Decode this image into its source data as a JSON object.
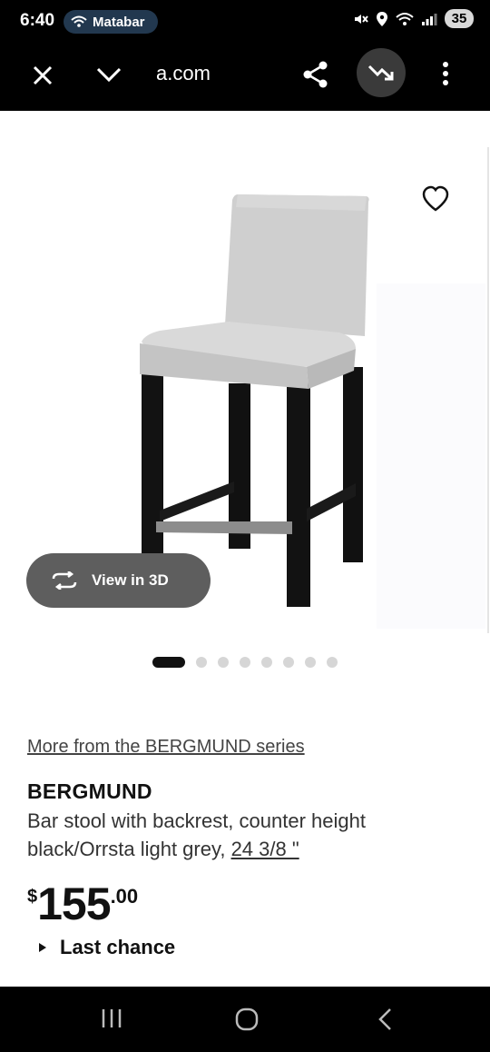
{
  "status_bar": {
    "time": "6:40",
    "network_chip": "Matabar",
    "battery": "35"
  },
  "browser": {
    "url": "a.com"
  },
  "product": {
    "view3d_label": "View in 3D",
    "carousel_count": 8,
    "carousel_active_index": 0,
    "series_link": "More from the BERGMUND series",
    "name": "BERGMUND",
    "description_line1": "Bar stool with backrest, counter height",
    "description_line2": "black/Orrsta light grey, ",
    "size_link": "24 3/8 \"",
    "price_currency": "$",
    "price_whole": "155",
    "price_decimal": ".00",
    "last_chance": "Last chance"
  },
  "colors": {
    "accent": "#22384f",
    "button_bg": "#5e5e5e"
  }
}
